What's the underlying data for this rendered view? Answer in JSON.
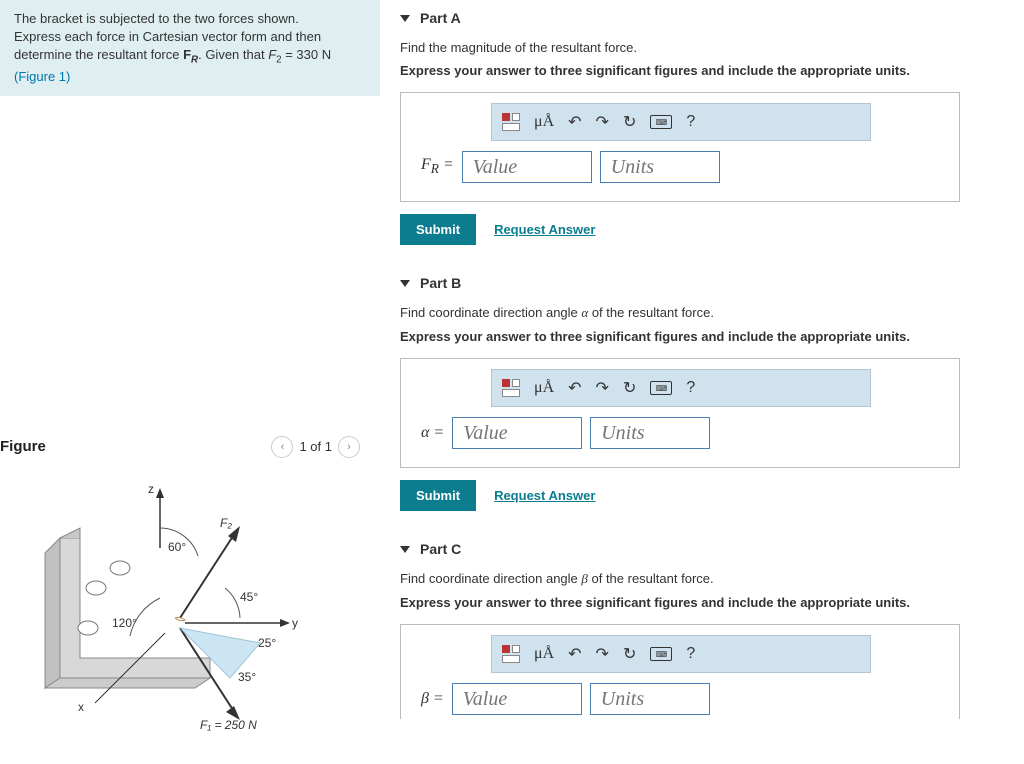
{
  "problem": {
    "line1": "The bracket is subjected to the two forces shown.",
    "line2": "Express each force in Cartesian vector form and then",
    "line3_prefix": "determine the resultant force ",
    "fr_symbol": "F",
    "fr_sub": "R",
    "line3_mid": ". Given that ",
    "f2_symbol": "F",
    "f2_sub": "2",
    "line3_val": " = 330 N",
    "figure_link": "(Figure 1)"
  },
  "figure": {
    "title": "Figure",
    "pager": "1 of 1",
    "labels": {
      "z": "z",
      "y": "y",
      "x": "x",
      "F2": "F₂",
      "a60": "60°",
      "a120": "120°",
      "a45": "45°",
      "a25": "25°",
      "a35": "35°",
      "F1": "F₁ = 250 N"
    }
  },
  "toolbar": {
    "mu": "μÅ",
    "undo": "↶",
    "redo": "↷",
    "reset": "↻",
    "help": "?"
  },
  "common": {
    "value_ph": "Value",
    "units_ph": "Units",
    "submit": "Submit",
    "request": "Request Answer"
  },
  "parts": {
    "A": {
      "title": "Part A",
      "instruction": "Find the magnitude of the resultant force.",
      "sub": "Express your answer to three significant figures and include the appropriate units.",
      "var_html": "F_R ="
    },
    "B": {
      "title": "Part B",
      "instruction_prefix": "Find coordinate direction angle ",
      "instruction_sym": "α",
      "instruction_suffix": " of the resultant force.",
      "sub": "Express your answer to three significant figures and include the appropriate units.",
      "var_html": "α ="
    },
    "C": {
      "title": "Part C",
      "instruction_prefix": "Find coordinate direction angle ",
      "instruction_sym": "β",
      "instruction_suffix": " of the resultant force.",
      "sub": "Express your answer to three significant figures and include the appropriate units.",
      "var_html": "β ="
    }
  }
}
